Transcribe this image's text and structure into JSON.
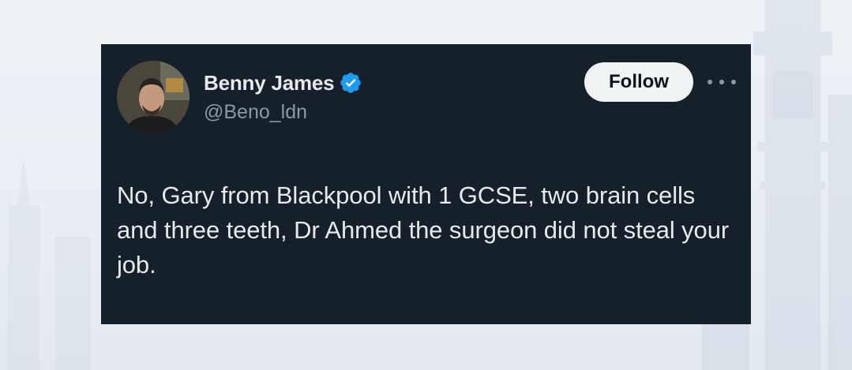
{
  "tweet": {
    "display_name": "Benny James",
    "handle": "@Beno_ldn",
    "verified": true,
    "follow_label": "Follow",
    "text": "No, Gary from Blackpool with 1 GCSE, two brain cells and three teeth, Dr Ahmed the surgeon did not steal your job.",
    "icons": {
      "verified": "verified-badge-icon",
      "more": "more-options-icon"
    }
  },
  "colors": {
    "card_background": "#15202b",
    "primary_text": "#e7e9ea",
    "secondary_text": "#8b98a5",
    "verified_blue": "#1d9bf0",
    "follow_background": "#eff3f4",
    "page_background": "#eef2f7"
  }
}
